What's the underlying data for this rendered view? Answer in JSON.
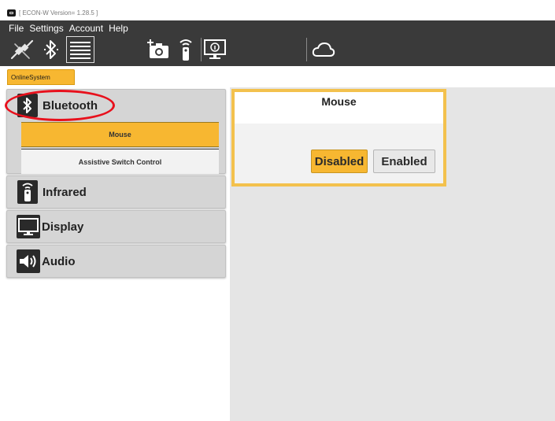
{
  "window": {
    "title": "[ ECON-W Version= 1.28.5 ]"
  },
  "menu": [
    {
      "label": "File"
    },
    {
      "label": "Settings"
    },
    {
      "label": "Account"
    },
    {
      "label": "Help"
    }
  ],
  "toolbar": {
    "icons": [
      "plug-disconnected-icon",
      "bluetooth-icon",
      "list-view-icon",
      "add-camera-icon",
      "infrared-remote-icon",
      "monitor-info-icon",
      "cloud-icon"
    ]
  },
  "tabs": [
    {
      "label": "OnlineSystem"
    }
  ],
  "categories": [
    {
      "label": "Bluetooth",
      "icon": "bluetooth-icon",
      "expanded": true,
      "subitems": [
        {
          "label": "Mouse",
          "selected": true
        },
        {
          "label": "Assistive Switch Control",
          "selected": false
        }
      ]
    },
    {
      "label": "Infrared",
      "icon": "infrared-remote-icon",
      "expanded": false
    },
    {
      "label": "Display",
      "icon": "monitor-icon",
      "expanded": false
    },
    {
      "label": "Audio",
      "icon": "speaker-icon",
      "expanded": false
    }
  ],
  "detail": {
    "title": "Mouse",
    "disabled_label": "Disabled",
    "enabled_label": "Enabled",
    "selected": "Disabled"
  },
  "colors": {
    "accent": "#f7b731",
    "toolbar": "#3a3a3a",
    "annotation": "#e8101c"
  }
}
